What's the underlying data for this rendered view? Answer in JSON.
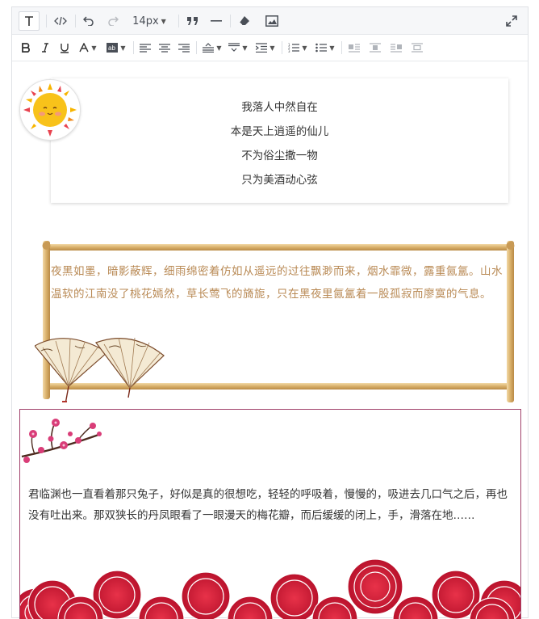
{
  "toolbar": {
    "font_size": "14px"
  },
  "poem": {
    "lines": [
      "我落人中然自在",
      "本是天上逍遥的仙儿",
      "不为俗尘撒一物",
      "只为美酒动心弦"
    ]
  },
  "scroll_section": {
    "text": "夜黑如墨，暗影蔽辉，细雨绵密着仿如从遥远的过往飘渺而来，烟水霏微，露重氤氲。山水温软的江南没了桃花嫣然，草长莺飞的旖旎，只在黑夜里氤氲着一股孤寂而廖寞的气息。"
  },
  "plum_section": {
    "text": "君临渊也一直看着那只兔子，好似是真的很想吃，轻轻的呼吸着，慢慢的，吸进去几口气之后，再也没有吐出来。那双狭长的丹凤眼看了一眼漫天的梅花瓣，而后缓缓的闭上，手，滑落在地……"
  },
  "colors": {
    "scroll_text": "#b98a55",
    "plum_border": "#a0416a",
    "wave_red": "#d8223b"
  }
}
